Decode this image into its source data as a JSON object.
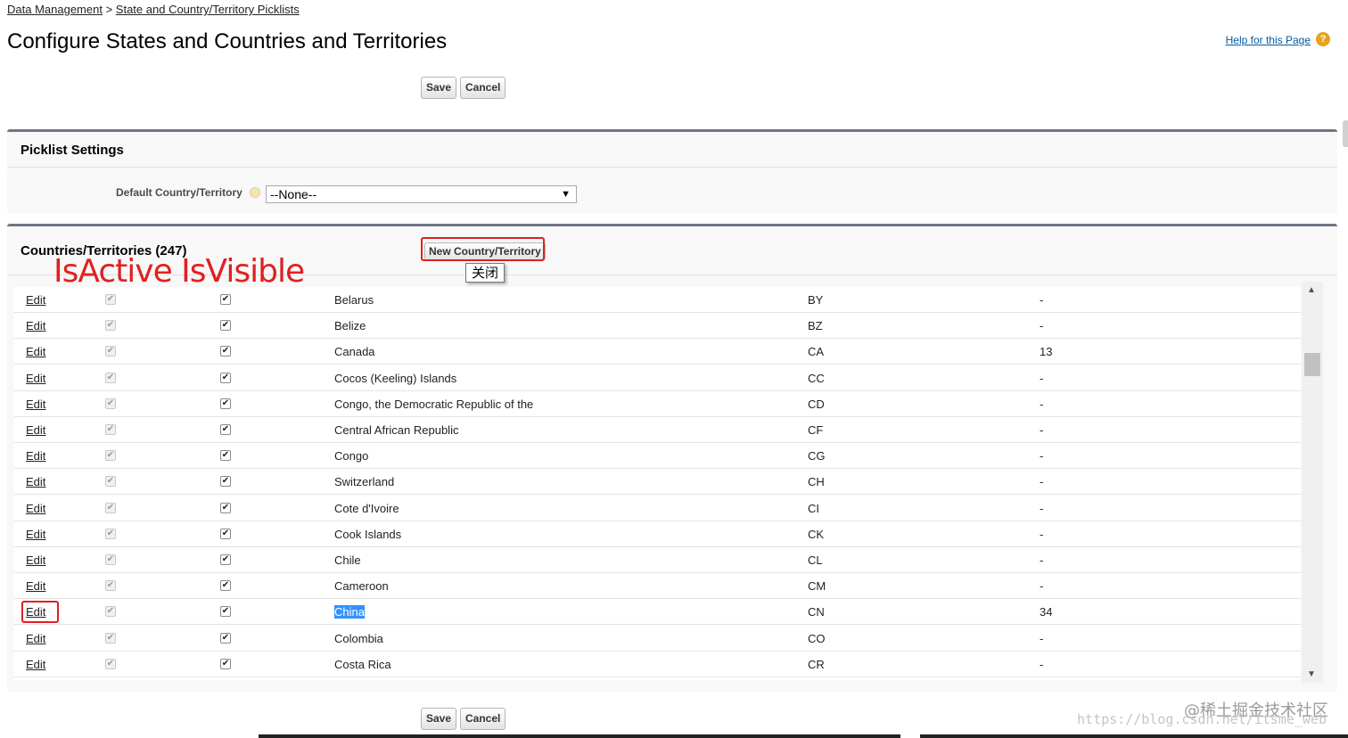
{
  "breadcrumb": {
    "root": "Data Management",
    "separator": ">",
    "current": "State and Country/Territory Picklists"
  },
  "page_title": "Configure States and Countries and Territories",
  "help": {
    "label": "Help for this Page",
    "icon": "question-icon",
    "icon_glyph": "?"
  },
  "buttons": {
    "save": "Save",
    "cancel": "Cancel"
  },
  "picklist_settings": {
    "title": "Picklist Settings",
    "default_country_label": "Default Country/Territory",
    "default_country_value": "--None--"
  },
  "countries": {
    "title": "Countries/Territories (247)",
    "new_button": "New Country/Territory",
    "tooltip": "关闭",
    "annotation_text": "IsActive IsVisible",
    "rows": [
      {
        "edit": "Edit",
        "active": true,
        "visible": true,
        "name": "Belarus",
        "code": "BY",
        "states": "-"
      },
      {
        "edit": "Edit",
        "active": true,
        "visible": true,
        "name": "Belize",
        "code": "BZ",
        "states": "-"
      },
      {
        "edit": "Edit",
        "active": true,
        "visible": true,
        "name": "Canada",
        "code": "CA",
        "states": "13"
      },
      {
        "edit": "Edit",
        "active": true,
        "visible": true,
        "name": "Cocos (Keeling) Islands",
        "code": "CC",
        "states": "-"
      },
      {
        "edit": "Edit",
        "active": true,
        "visible": true,
        "name": "Congo, the Democratic Republic of the",
        "code": "CD",
        "states": "-"
      },
      {
        "edit": "Edit",
        "active": true,
        "visible": true,
        "name": "Central African Republic",
        "code": "CF",
        "states": "-"
      },
      {
        "edit": "Edit",
        "active": true,
        "visible": true,
        "name": "Congo",
        "code": "CG",
        "states": "-"
      },
      {
        "edit": "Edit",
        "active": true,
        "visible": true,
        "name": "Switzerland",
        "code": "CH",
        "states": "-"
      },
      {
        "edit": "Edit",
        "active": true,
        "visible": true,
        "name": "Cote d'Ivoire",
        "code": "CI",
        "states": "-"
      },
      {
        "edit": "Edit",
        "active": true,
        "visible": true,
        "name": "Cook Islands",
        "code": "CK",
        "states": "-"
      },
      {
        "edit": "Edit",
        "active": true,
        "visible": true,
        "name": "Chile",
        "code": "CL",
        "states": "-"
      },
      {
        "edit": "Edit",
        "active": true,
        "visible": true,
        "name": "Cameroon",
        "code": "CM",
        "states": "-"
      },
      {
        "edit": "Edit",
        "active": true,
        "visible": true,
        "name": "China",
        "code": "CN",
        "states": "34",
        "selected": true
      },
      {
        "edit": "Edit",
        "active": true,
        "visible": true,
        "name": "Colombia",
        "code": "CO",
        "states": "-"
      },
      {
        "edit": "Edit",
        "active": true,
        "visible": true,
        "name": "Costa Rica",
        "code": "CR",
        "states": "-"
      }
    ]
  },
  "watermark": {
    "cn": "@稀土掘金技术社区",
    "url": "https://blog.csdn.net/itsme_web"
  },
  "colors": {
    "annotation": "#e02020",
    "selection": "#3390ff",
    "panel_border": "#6f7584",
    "help_icon": "#e8a21c"
  }
}
